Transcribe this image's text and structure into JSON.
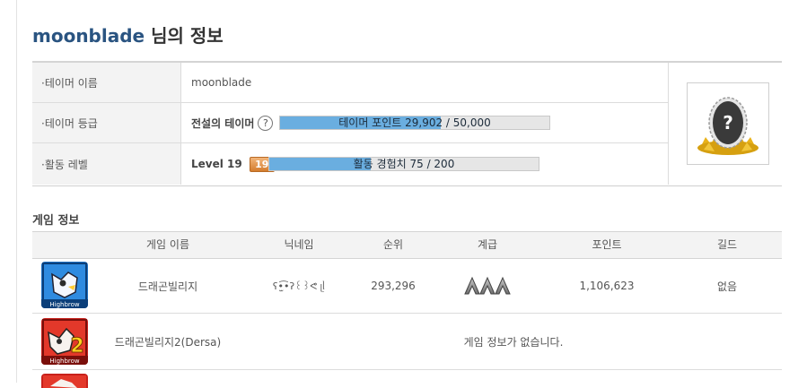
{
  "page": {
    "title_name": "moonblade",
    "title_suffix": " 님의 정보"
  },
  "profile": {
    "rows": [
      {
        "label": "·테이머 이름",
        "value": "moonblade"
      },
      {
        "label": "·테이머 등급",
        "value": "전설의 테이머",
        "help": "?",
        "bar_text": "테이머 포인트 29,902 / 50,000",
        "bar_progress": 0.598
      },
      {
        "label": "·활동 레벨",
        "value": "Level 19",
        "badge": "19",
        "bar_text": "활동 경험치 75 / 200",
        "bar_progress": 0.375
      }
    ],
    "avatar": {
      "icon": "mystery-egg-icon",
      "symbol": "?"
    }
  },
  "games": {
    "section_title": "게임 정보",
    "columns": [
      "게임 이름",
      "닉네임",
      "순위",
      "계급",
      "포인트",
      "길드"
    ],
    "rows": [
      {
        "icon": "dragon-village-icon",
        "name": "드래곤빌리지",
        "nickname": "ʕ•̫͡•ʔ꒰꒱ᕙ ᥨᥣ",
        "rank": "293,296",
        "grade_icon": "chevron-rank-icon",
        "points": "1,106,623",
        "guild": "없음"
      },
      {
        "icon": "dragon-village-2-icon",
        "name": "드래곤빌리지2(Dersa)",
        "message": "게임 정보가 없습니다."
      },
      {
        "icon": "dragon-village-icon-partial"
      }
    ]
  },
  "colors": {
    "title": "#2a5481",
    "bar_fill": "#6aaee0",
    "bar_bg": "#e6e6e6",
    "badge": "#e0924a"
  }
}
